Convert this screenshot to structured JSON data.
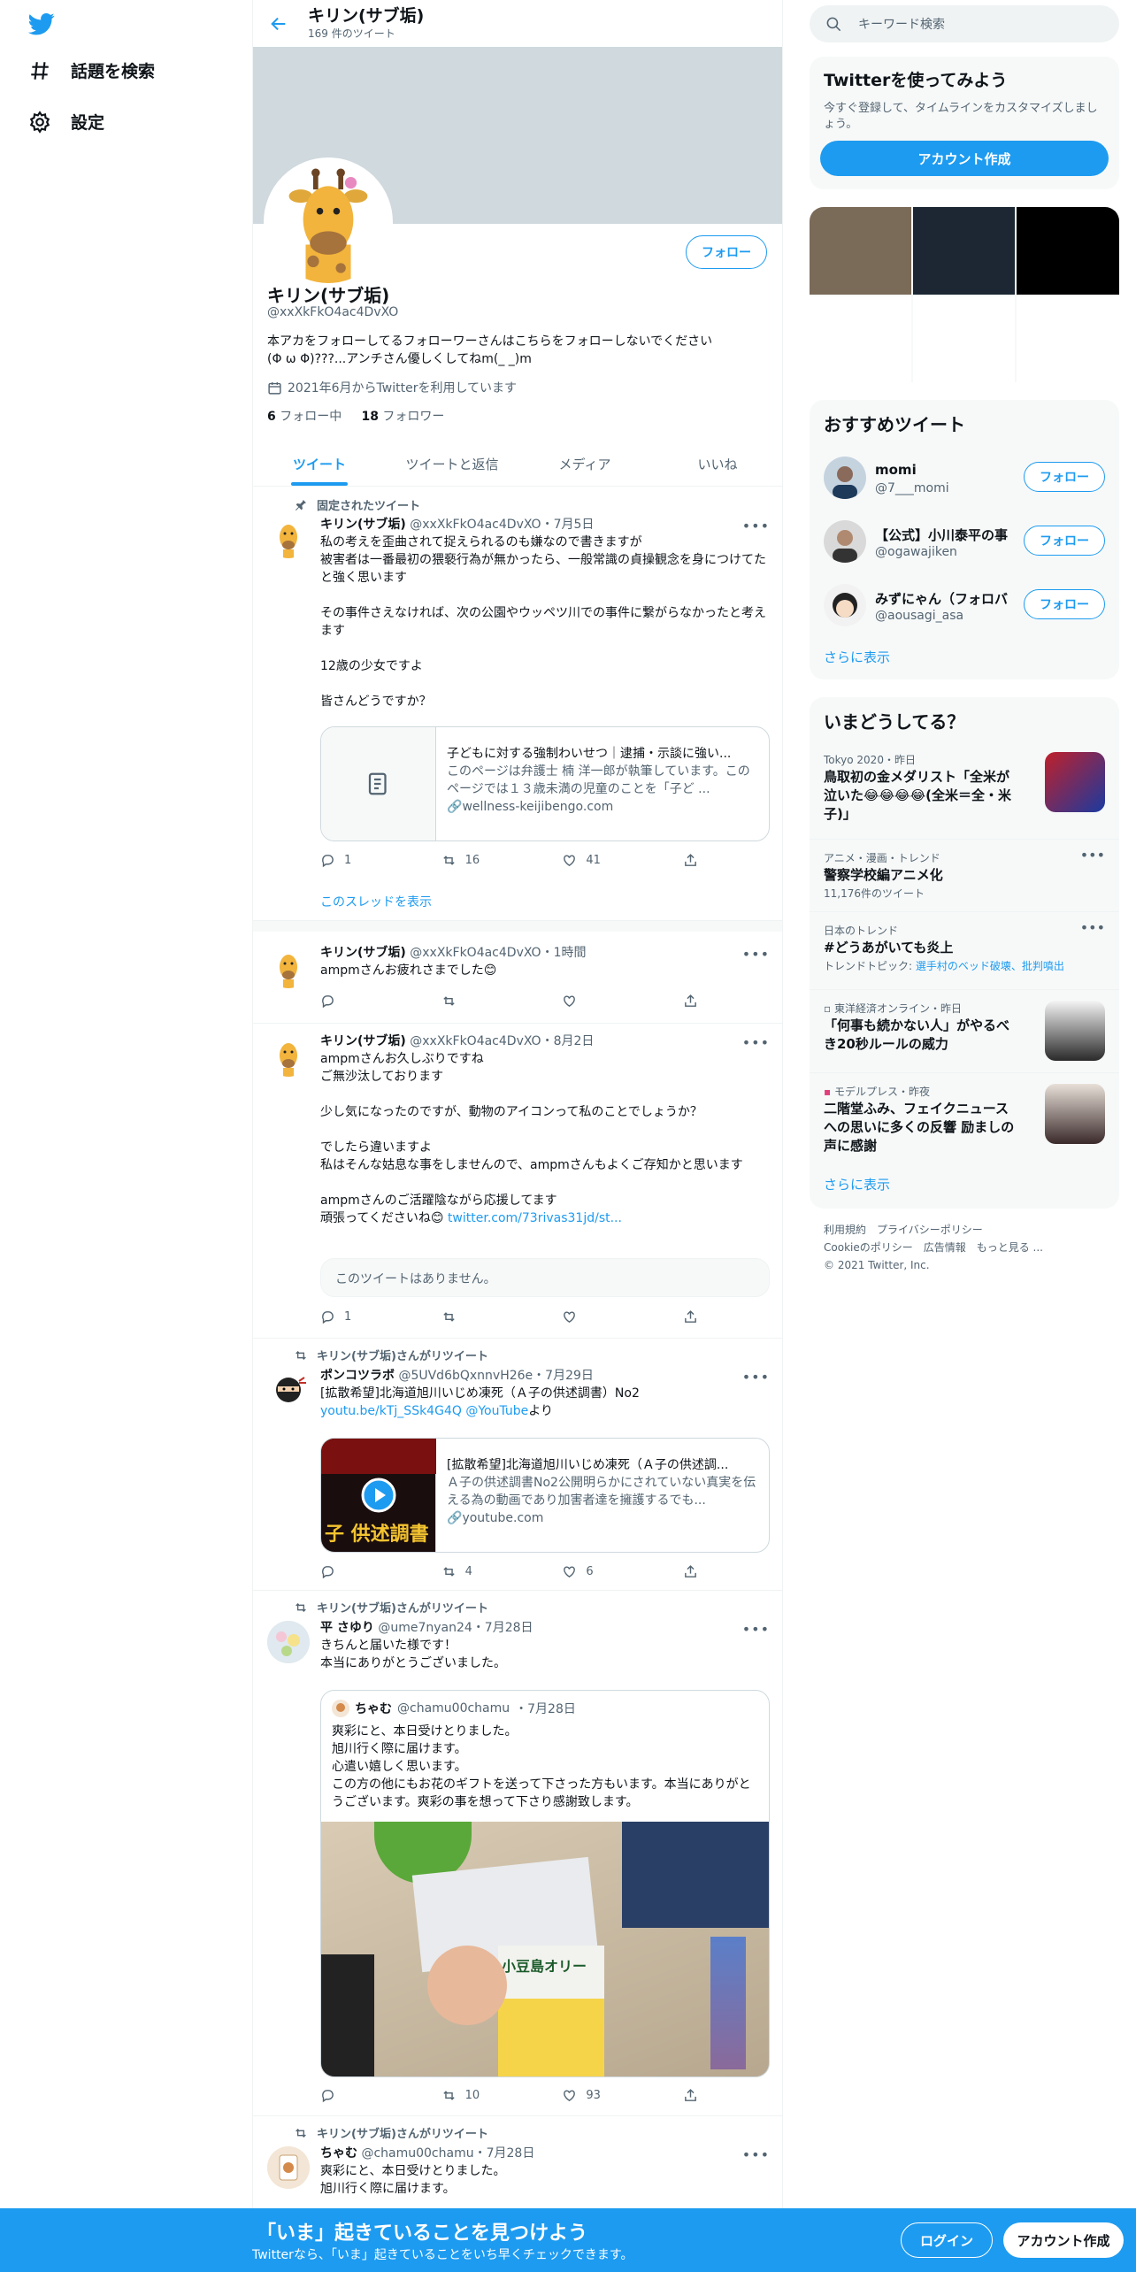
{
  "nav": {
    "explore": "話題を検索",
    "settings": "設定"
  },
  "header": {
    "name": "キリン(サブ垢)",
    "count": "169 件のツイート"
  },
  "profile": {
    "follow": "フォロー",
    "name": "キリン(サブ垢)",
    "handle": "@xxXkFkO4ac4DvXO",
    "bio_line1": "本アカをフォローしてるフォローワーさんはこちらをフォローしないでください",
    "bio_line2": "(Φ ω Φ)???...アンチさん優しくしてねm(_ _)m",
    "joined": "2021年6月からTwitterを利用しています",
    "following_count": "6",
    "following_label": "フォロー中",
    "followers_count": "18",
    "followers_label": "フォロワー"
  },
  "tabs": [
    "ツイート",
    "ツイートと返信",
    "メディア",
    "いいね"
  ],
  "tweets": {
    "t1": {
      "pinned": "固定されたツイート",
      "name": "キリン(サブ垢)",
      "handle": "@xxXkFkO4ac4DvXO",
      "time": "・7月5日",
      "text": "私の考えを歪曲されて捉えられるのも嫌なので書きますが\n被害者は一番最初の猥褻行為が無かったら、一般常識の貞操観念を身につけてたと強く思います\n\nその事件さえなければ、次の公園やウッペツ川での事件に繋がらなかったと考えます\n\n12歳の少女ですよ\n\n皆さんどうですか？",
      "card_title": "子どもに対する強制わいせつ｜逮捕・示談に強い...",
      "card_desc": "このページは弁護士 楠 洋一郎が執筆しています。このページでは１３歳未満の児童のことを「子ど ...",
      "card_domain": "wellness-keijibengo.com",
      "reply": "1",
      "retweet": "16",
      "like": "41",
      "thread": "このスレッドを表示"
    },
    "t2": {
      "name": "キリン(サブ垢)",
      "handle": "@xxXkFkO4ac4DvXO",
      "time": "・1時間",
      "text": "ampmさんお疲れさまでした😊"
    },
    "t3": {
      "name": "キリン(サブ垢)",
      "handle": "@xxXkFkO4ac4DvXO",
      "time": "・8月2日",
      "text": "ampmさんお久しぶりですね\nご無沙汰しております\n\n少し気になったのですが、動物のアイコンって私のことでしょうか？\n\nでしたら違いますよ\n私はそんな姑息な事をしませんので、ampmさんもよくご存知かと思います\n\nampmさんのご活躍陰ながら応援してます\n頑張ってくださいね😊 ",
      "link": "twitter.com/73rivas31jd/st...",
      "unavailable": "このツイートはありません。",
      "reply": "1"
    },
    "t4": {
      "social": "キリン(サブ垢)さんがリツイート",
      "name": "ポンコツラボ",
      "handle": "@5UVd6bQxnnvH26e",
      "time": "・7月29日",
      "text": "[拡散希望]北海道旭川いじめ凍死（Ａ子の供述調書）No2",
      "link1": "youtu.be/kTj_SSk4G4Q",
      "link2": "@YouTube",
      "suffix": "より",
      "card_title": "[拡散希望]北海道旭川いじめ凍死（Ａ子の供述調...",
      "card_desc": "Ａ子の供述調書No2公開明らかにされていない真実を伝える為の動画であり加害者達を擁護するでも...",
      "card_domain": "youtube.com",
      "thumb_text": "子 供述調書",
      "retweet": "4",
      "like": "6"
    },
    "t5": {
      "social": "キリン(サブ垢)さんがリツイート",
      "name": "平 さゆり",
      "handle": "@ume7nyan24",
      "time": "・7月28日",
      "text": "きちんと届いた様です！\n本当にありがとうございました。",
      "q_name": "ちゃむ",
      "q_handle": "@chamu00chamu",
      "q_time": "・7月28日",
      "q_text": "爽彩にと、本日受けとりました。\n旭川行く際に届けます。\n心遣い嬉しく思います。\nこの方の他にもお花のギフトを送って下さった方もいます。本当にありがとうございます。爽彩の事を想って下さり感謝致します。",
      "photo_label": "小豆島オリー",
      "retweet": "10",
      "like": "93"
    },
    "t6": {
      "social": "キリン(サブ垢)さんがリツイート",
      "name": "ちゃむ",
      "handle": "@chamu00chamu",
      "time": "・7月28日",
      "text": "爽彩にと、本日受けとりました。\n旭川行く際に届けます。"
    }
  },
  "right": {
    "search_placeholder": "キーワード検索",
    "try_title": "Twitterを使ってみよう",
    "try_desc": "今すぐ登録して、タイムラインをカスタマイズしましょう。",
    "signup": "アカウント作成",
    "rec_title": "おすすめツイート",
    "recs": [
      {
        "name": "momi",
        "handle": "@7___momi",
        "btn": "フォロー"
      },
      {
        "name": "【公式】小川泰平の事",
        "handle": "@ogawajiken",
        "btn": "フォロー"
      },
      {
        "name": "みずにゃん（フォロバ",
        "handle": "@aousagi_asa",
        "btn": "フォロー"
      }
    ],
    "show_more": "さらに表示",
    "trends_title": "いまどうしてる？",
    "trends": [
      {
        "meta": "Tokyo 2020・昨日",
        "headline": "鳥取初の金メダリスト「全米が泣いた😂😂😂😂(全米＝全・米子)」"
      },
      {
        "meta": "アニメ・漫画・トレンド",
        "headline": "警察学校編アニメ化",
        "sub": "11,176件のツイート"
      },
      {
        "meta": "日本のトレンド",
        "headline": "#どうあがいても炎上",
        "sub_label": "トレンドトピック: ",
        "sub_link": "選手村のベッド破壊、批判噴出"
      },
      {
        "meta": "東洋経済オンライン・昨日",
        "headline": "「何事も続かない人」がやるべき20秒ルールの威力"
      },
      {
        "meta": "モデルプレス・昨夜",
        "headline": "二階堂ふみ、フェイクニュースへの思いに多くの反響 励ましの声に感謝"
      }
    ],
    "footer_line1": "利用規約　プライバシーポリシー",
    "footer_line2": "Cookieのポリシー　広告情報　もっと見る ...",
    "footer_line3": "© 2021 Twitter, Inc."
  },
  "bottom": {
    "title": "「いま」起きていることを見つけよう",
    "sub": "Twitterなら、「いま」起きていることをいち早くチェックできます。",
    "login": "ログイン",
    "signup": "アカウント作成"
  }
}
